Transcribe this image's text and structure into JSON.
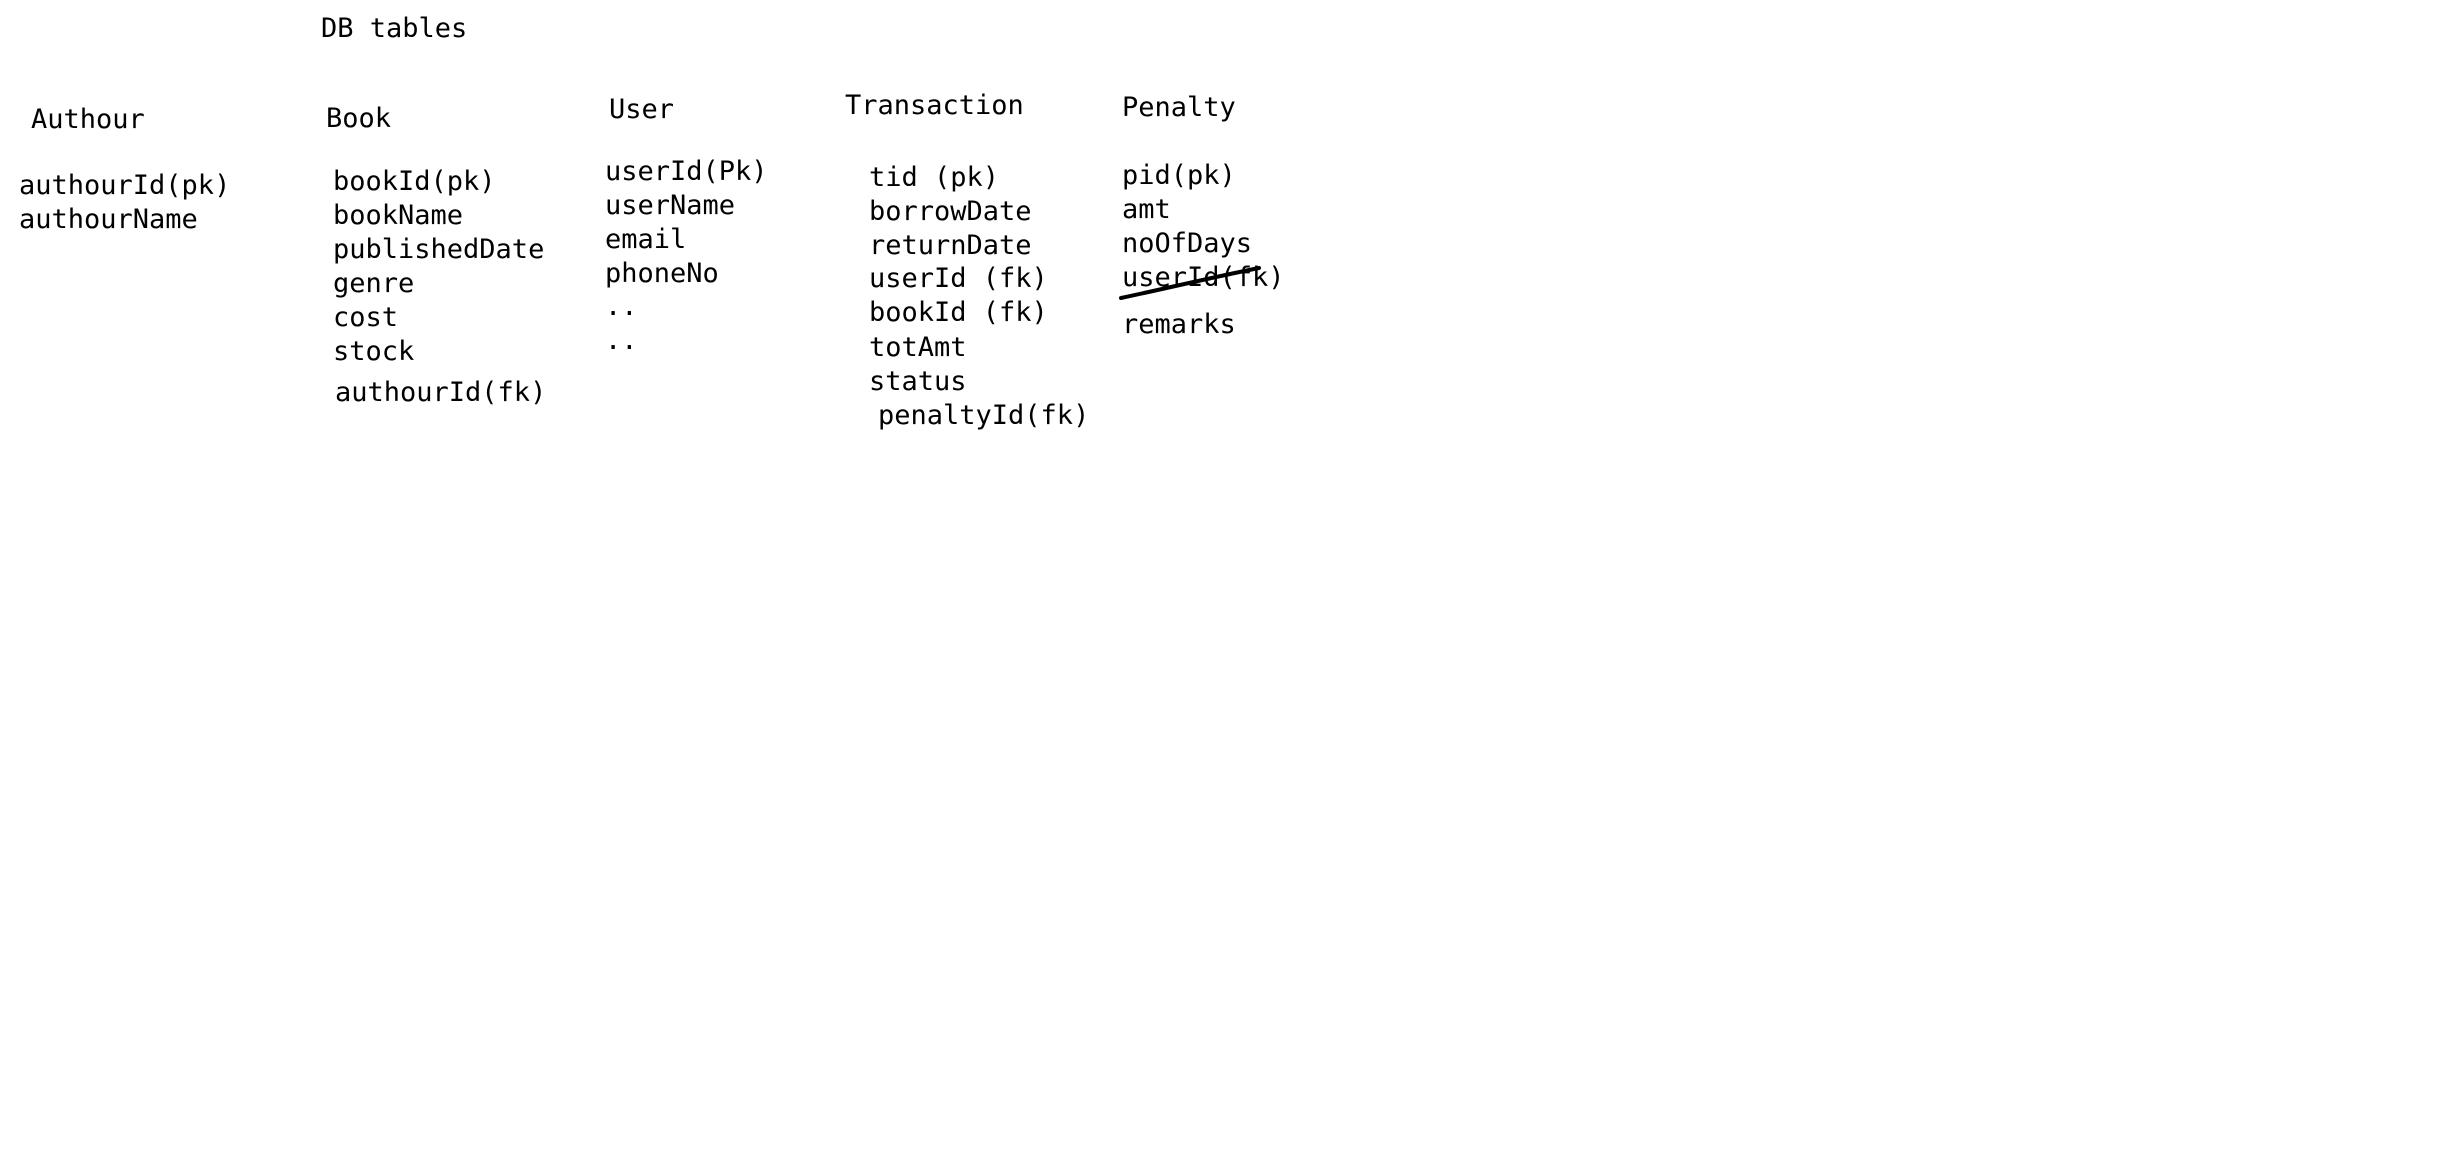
{
  "title": "DB tables",
  "tables": {
    "authour": {
      "name": "Authour",
      "fields": [
        "authourId(pk)",
        "authourName"
      ]
    },
    "book": {
      "name": "Book",
      "fields": [
        "bookId(pk)",
        "bookName",
        "publishedDate",
        "genre",
        "cost",
        "stock",
        "authourId(fk)"
      ]
    },
    "user": {
      "name": "User",
      "fields": [
        "userId(Pk)",
        "userName",
        "email",
        "phoneNo",
        "..",
        ".."
      ]
    },
    "transaction": {
      "name": "Transaction",
      "fields": [
        "tid (pk)",
        "borrowDate",
        "returnDate",
        "userId (fk)",
        "bookId (fk)",
        "totAmt",
        "status",
        "penaltyId(fk)"
      ]
    },
    "penalty": {
      "name": "Penalty",
      "fields": [
        "pid(pk)",
        "amt",
        "noOfDays",
        "userId(fk)",
        "remarks"
      ],
      "struck_field": "userId(fk)"
    }
  }
}
